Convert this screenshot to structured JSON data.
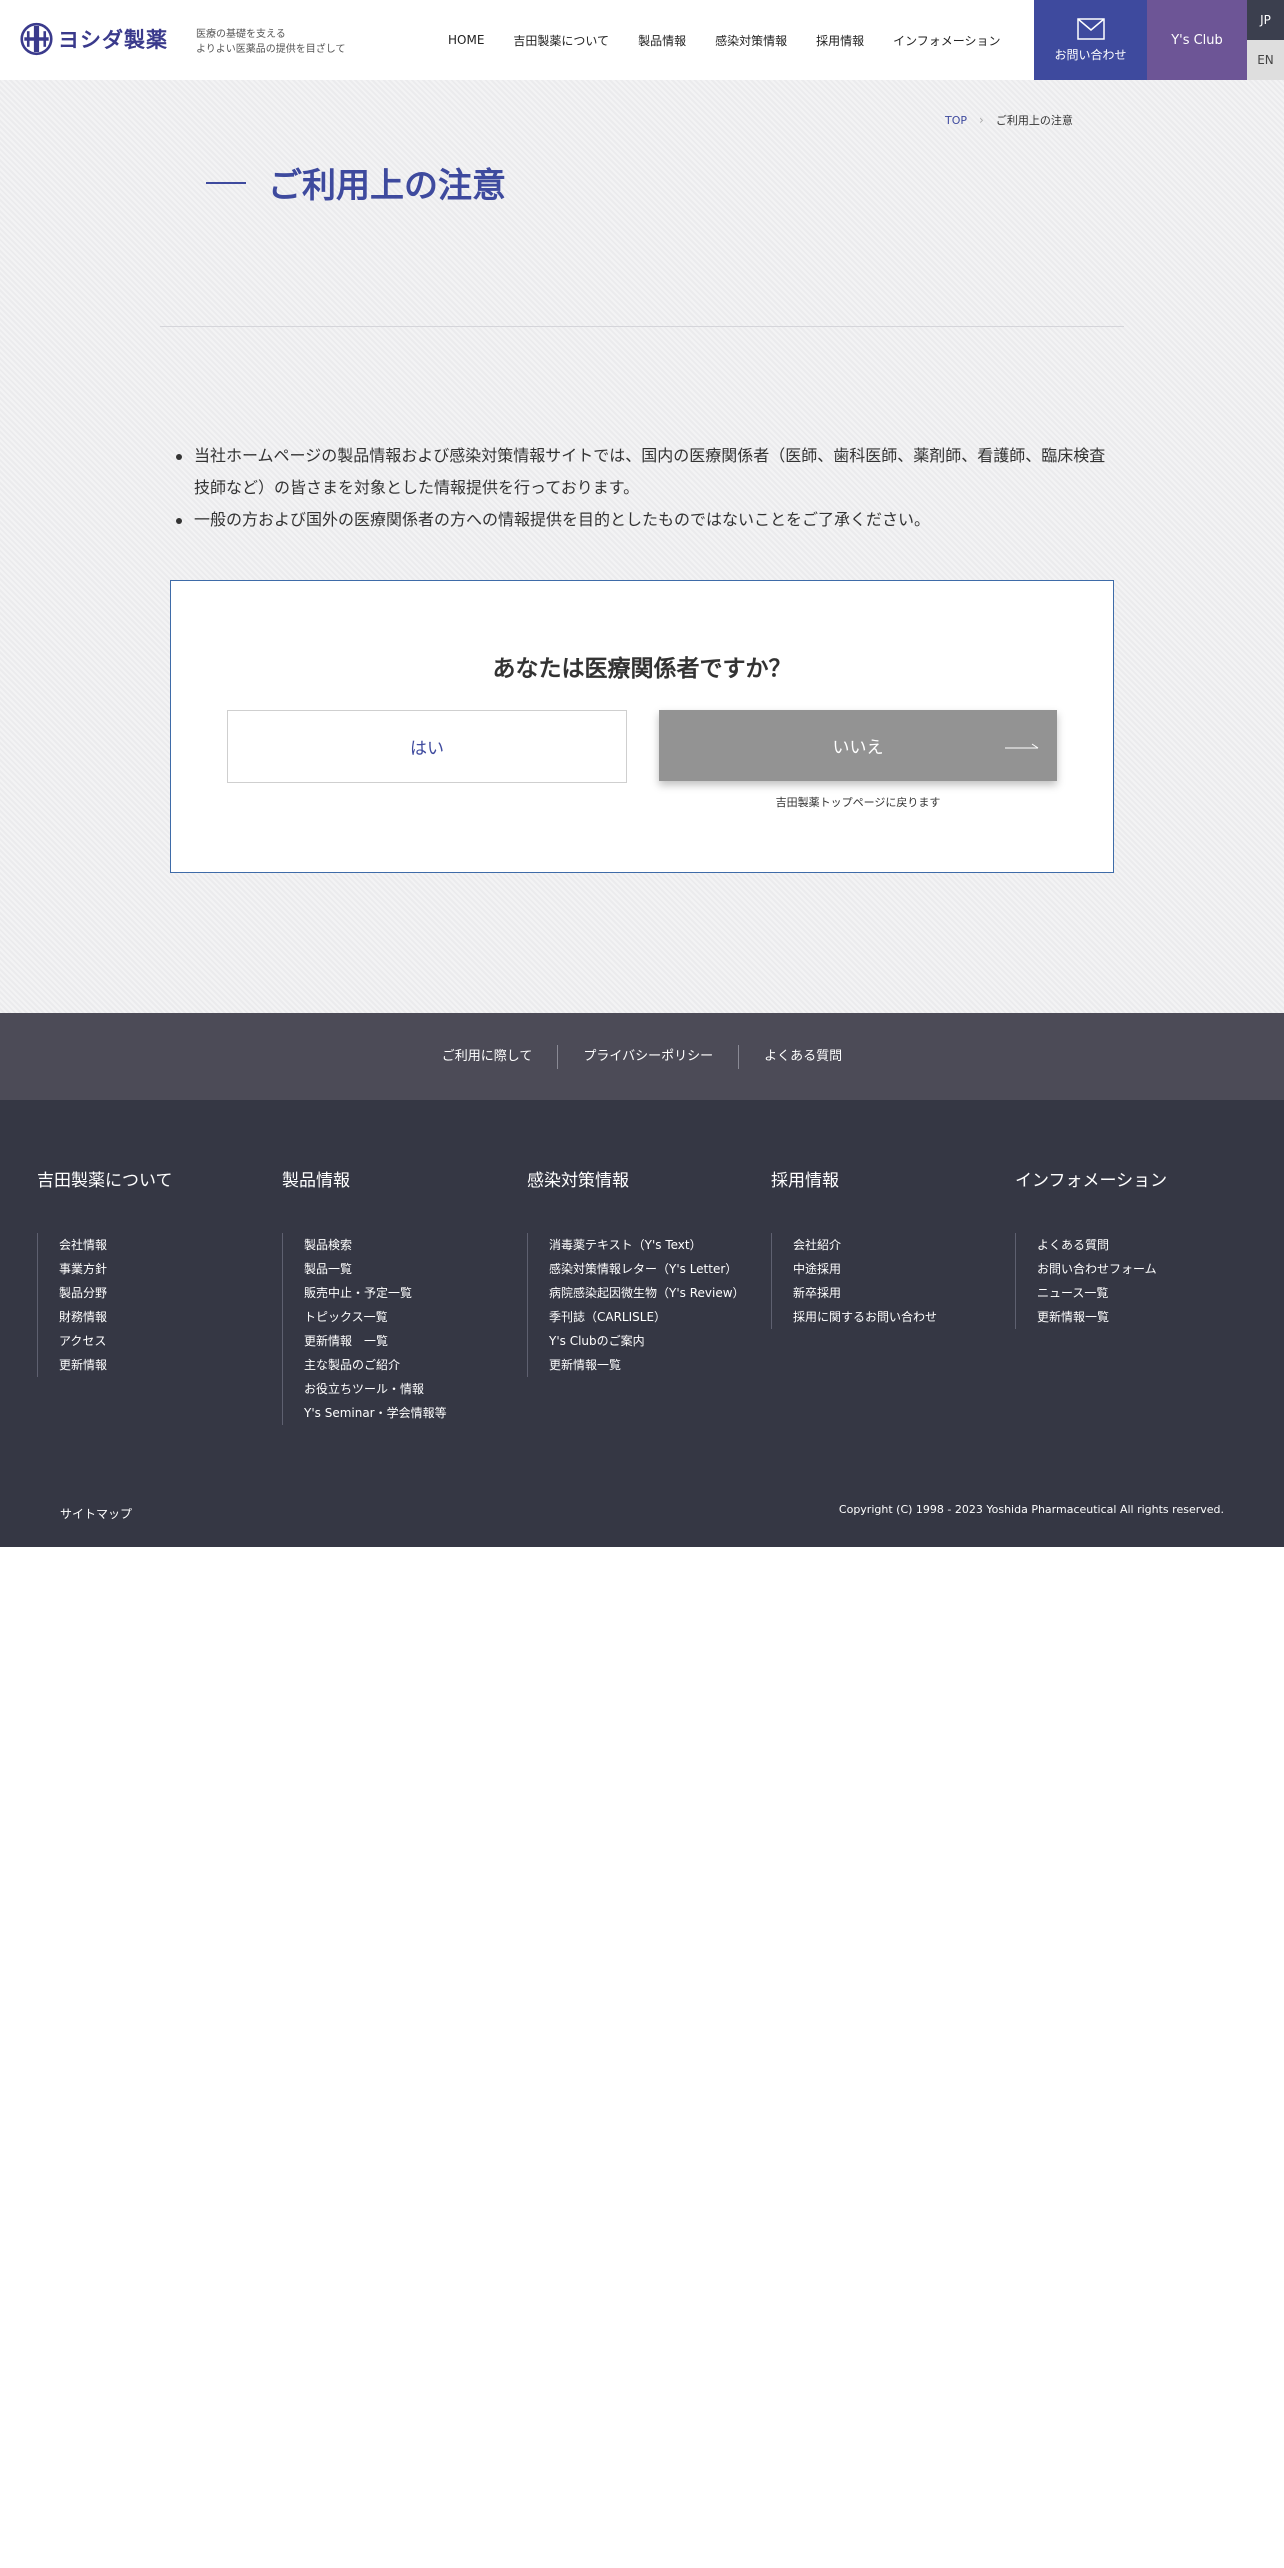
{
  "header": {
    "logo_text": "ヨシダ製薬",
    "tagline_line1": "医療の基礎を支える",
    "tagline_line2": "よりよい医薬品の提供を目ざして",
    "nav": [
      "HOME",
      "吉田製薬について",
      "製品情報",
      "感染対策情報",
      "採用情報",
      "インフォメーション"
    ],
    "contact_label": "お問い合わせ",
    "ys_club_label": "Y's Club",
    "lang_jp": "JP",
    "lang_en": "EN",
    "icons": {
      "contact": "mail-icon"
    },
    "colors": {
      "contact_bg": "#3e4a9e",
      "ys_bg": "#6d5596"
    }
  },
  "breadcrumb": {
    "top": "TOP",
    "current": "ご利用上の注意"
  },
  "page_title": "ご利用上の注意",
  "notices": [
    "当社ホームページの製品情報および感染対策情報サイトでは、国内の医療関係者（医師、歯科医師、薬剤師、看護師、臨床検査技師など）の皆さまを対象とした情報提供を行っております。",
    "一般の方および国外の医療関係者の方への情報提供を目的としたものではないことをご了承ください。"
  ],
  "confirm": {
    "question": "あなたは医療関係者ですか？",
    "yes": "はい",
    "no": "いいえ",
    "no_note": "吉田製薬トップページに戻ります"
  },
  "footer_links": [
    "ご利用に際して",
    "プライバシーポリシー",
    "よくある質問"
  ],
  "footer_columns": [
    {
      "title": "吉田製薬について",
      "items": [
        "会社情報",
        "事業方針",
        "製品分野",
        "財務情報",
        "アクセス",
        "更新情報"
      ]
    },
    {
      "title": "製品情報",
      "items": [
        "製品検索",
        "製品一覧",
        "販売中止・予定一覧",
        "トピックス一覧",
        "更新情報　一覧",
        "主な製品のご紹介",
        "お役立ちツール・情報",
        "Y's Seminar・学会情報等"
      ]
    },
    {
      "title": "感染対策情報",
      "items": [
        "消毒薬テキスト（Y's Text）",
        "感染対策情報レター（Y's Letter）",
        "病院感染起因微生物（Y's Review）",
        "季刊誌（CARLISLE）",
        "Y's Clubのご案内",
        "更新情報一覧"
      ]
    },
    {
      "title": "採用情報",
      "items": [
        "会社紹介",
        "中途採用",
        "新卒採用",
        "採用に関するお問い合わせ"
      ]
    },
    {
      "title": "インフォメーション",
      "items": [
        "よくある質問",
        "お問い合わせフォーム",
        "ニュース一覧",
        "更新情報一覧"
      ]
    }
  ],
  "sitemap": "サイトマップ",
  "copyright": "Copyright (C) 1998 - 2023 Yoshida Pharmaceutical All rights reserved."
}
